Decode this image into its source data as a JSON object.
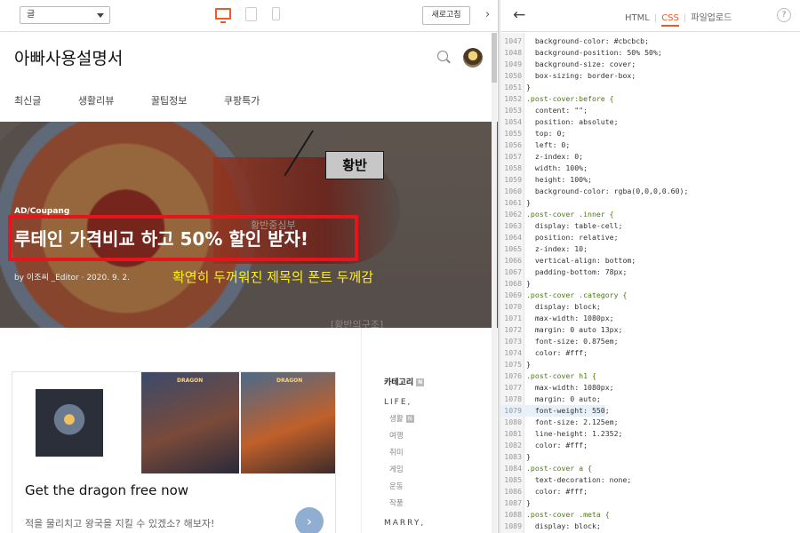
{
  "toolbar": {
    "select_value": "글",
    "refresh_label": "새로고침"
  },
  "right_bar": {
    "tabs": [
      "HTML",
      "CSS",
      "파일업로드"
    ],
    "help_label": "?"
  },
  "blog": {
    "title": "아빠사용설명서",
    "nav": [
      "최신글",
      "생활리뷰",
      "꿀팁정보",
      "쿠팡특가"
    ]
  },
  "hero": {
    "image_label": "황반",
    "bg_caption": "황반중심부",
    "bg_caption2": "[황반의구조]",
    "category": "AD/Coupang",
    "post_title": "루테인 가격비교 하고 50% 할인 받자!",
    "meta": "by 이조씨 _Editor · 2020. 9. 2.",
    "annotation": "확연히 두꺼워진 제목의 폰트 두께감"
  },
  "ad": {
    "headline": "Get the dragon free now",
    "description": "적을 물리치고 왕국을 지킬 수 있겠소? 해보자!",
    "thumb_text_1": "DRAGON",
    "thumb_text_2": "DRAGON"
  },
  "sidebar": {
    "category_head": "카테고리",
    "groups": [
      {
        "label": "LIFE,",
        "items": [
          "생활",
          "여행",
          "취미",
          "게임",
          "운동",
          "작품"
        ]
      },
      {
        "label": "MARRY,",
        "items": []
      }
    ]
  },
  "code": {
    "lines": [
      {
        "n": "1047",
        "t": "  background-color: #cbcbcb;"
      },
      {
        "n": "1048",
        "t": "  background-position: 50% 50%;"
      },
      {
        "n": "1049",
        "t": "  background-size: cover;"
      },
      {
        "n": "1050",
        "t": "  box-sizing: border-box;"
      },
      {
        "n": "1051",
        "t": "}"
      },
      {
        "n": "1052",
        "t": ".post-cover:before {"
      },
      {
        "n": "1053",
        "t": "  content: \"\";"
      },
      {
        "n": "1054",
        "t": "  position: absolute;"
      },
      {
        "n": "1055",
        "t": "  top: 0;"
      },
      {
        "n": "1056",
        "t": "  left: 0;"
      },
      {
        "n": "1057",
        "t": "  z-index: 0;"
      },
      {
        "n": "1058",
        "t": "  width: 100%;"
      },
      {
        "n": "1059",
        "t": "  height: 100%;"
      },
      {
        "n": "1060",
        "t": "  background-color: rgba(0,0,0,0.60);"
      },
      {
        "n": "1061",
        "t": "}"
      },
      {
        "n": "1062",
        "t": ".post-cover .inner {"
      },
      {
        "n": "1063",
        "t": "  display: table-cell;"
      },
      {
        "n": "1064",
        "t": "  position: relative;"
      },
      {
        "n": "1065",
        "t": "  z-index: 10;"
      },
      {
        "n": "1066",
        "t": "  vertical-align: bottom;"
      },
      {
        "n": "1067",
        "t": "  padding-bottom: 78px;"
      },
      {
        "n": "1068",
        "t": "}"
      },
      {
        "n": "1069",
        "t": ".post-cover .category {"
      },
      {
        "n": "1070",
        "t": "  display: block;"
      },
      {
        "n": "1071",
        "t": "  max-width: 1080px;"
      },
      {
        "n": "1072",
        "t": "  margin: 0 auto 13px;"
      },
      {
        "n": "1073",
        "t": "  font-size: 0.875em;"
      },
      {
        "n": "1074",
        "t": "  color: #fff;"
      },
      {
        "n": "1075",
        "t": "}"
      },
      {
        "n": "1076",
        "t": ".post-cover h1 {"
      },
      {
        "n": "1077",
        "t": "  max-width: 1080px;"
      },
      {
        "n": "1078",
        "t": "  margin: 0 auto;"
      },
      {
        "n": "1079",
        "t": "  font-weight: 550;"
      },
      {
        "n": "1080",
        "t": "  font-size: 2.125em;"
      },
      {
        "n": "1081",
        "t": "  line-height: 1.2352;"
      },
      {
        "n": "1082",
        "t": "  color: #fff;"
      },
      {
        "n": "1083",
        "t": "}"
      },
      {
        "n": "1084",
        "t": ".post-cover a {"
      },
      {
        "n": "1085",
        "t": "  text-decoration: none;"
      },
      {
        "n": "1086",
        "t": "  color: #fff;"
      },
      {
        "n": "1087",
        "t": "}"
      },
      {
        "n": "1088",
        "t": ".post-cover .meta {"
      },
      {
        "n": "1089",
        "t": "  display: block;"
      }
    ],
    "highlight_line": "1079"
  },
  "colors": {
    "accent": "#f05a28",
    "highlight_box": "#e8141c",
    "annotation": "#ffee1a"
  }
}
